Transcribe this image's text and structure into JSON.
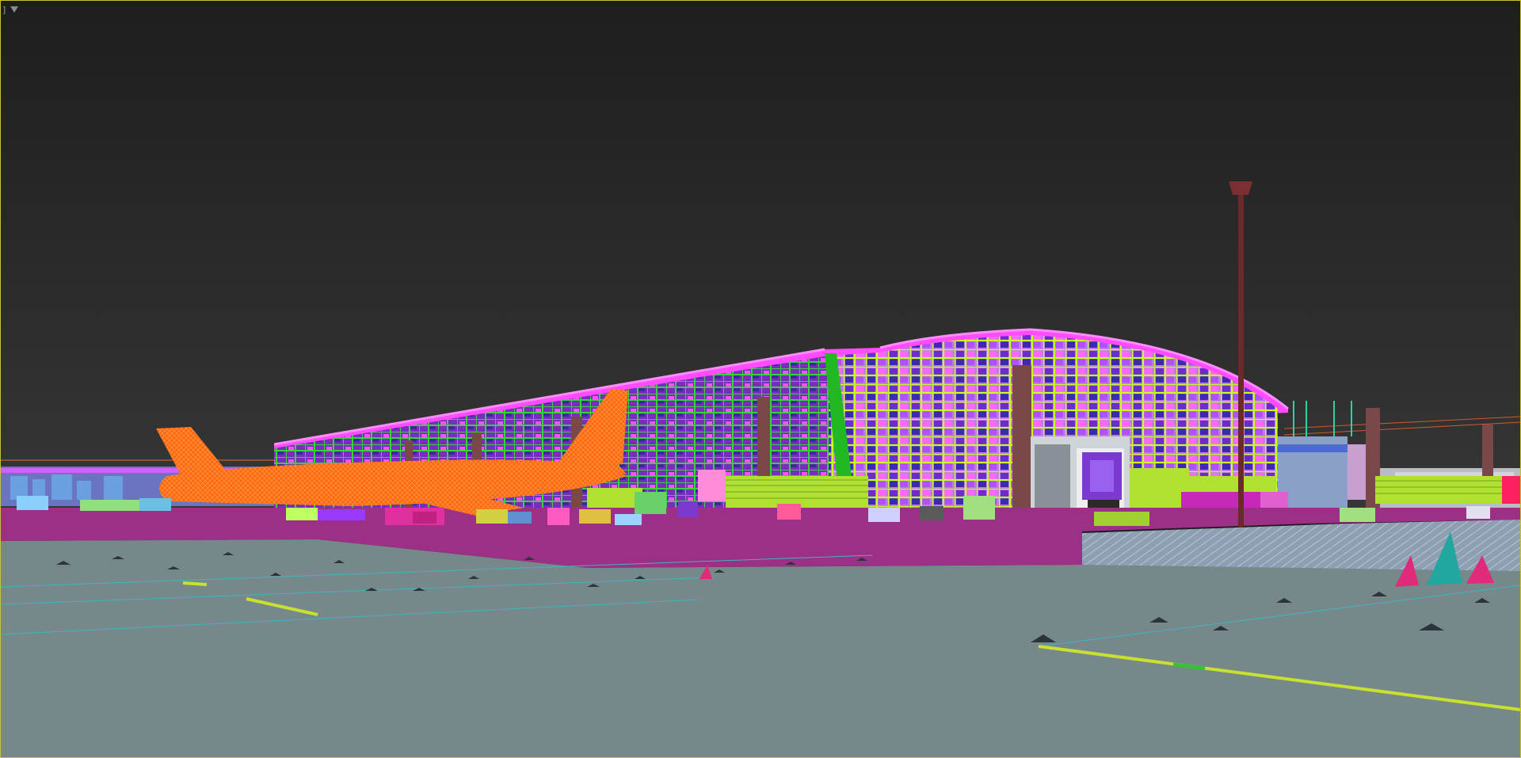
{
  "viewport": {
    "menu_label": "]",
    "menu_icon": "filter-triangle-icon",
    "render_mode": "wireframe-object-colors",
    "colors": {
      "frame": "#c8c03a",
      "sky_top": "#1e1e1e",
      "sky_bottom": "#353535",
      "ground": "#76888a",
      "apron": "#9c2f86",
      "terminal_roof": "#ff4cff",
      "terminal_grid": "#c8ff1e",
      "terminal_green": "#35e035",
      "airplane": "#ff6a10",
      "mast": "#6a2a2a",
      "jetbridge": "#b0e030",
      "taxi_line": "#c8e030"
    }
  }
}
